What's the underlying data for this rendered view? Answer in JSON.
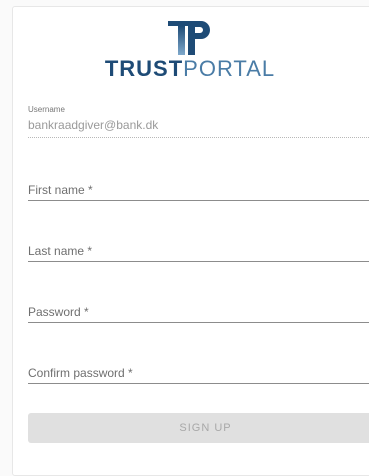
{
  "logo": {
    "mark_text": "TP",
    "word_bold": "TRUST",
    "word_light": "PORTAL"
  },
  "form": {
    "username": {
      "label": "Username",
      "value": "bankraadgiver@bank.dk"
    },
    "first_name": {
      "placeholder": "First name *"
    },
    "last_name": {
      "placeholder": "Last name *"
    },
    "password": {
      "placeholder": "Password *",
      "toggle_icon": "eye-icon"
    },
    "confirm_password": {
      "placeholder": "Confirm password *",
      "toggle_icon": "eye-icon"
    },
    "submit_label": "SIGN UP"
  },
  "colors": {
    "brand_dark": "#1e4b76",
    "brand_light": "#4a7ca6",
    "button_disabled_bg": "#e0e0e0",
    "button_disabled_text": "#a8a8a8"
  }
}
